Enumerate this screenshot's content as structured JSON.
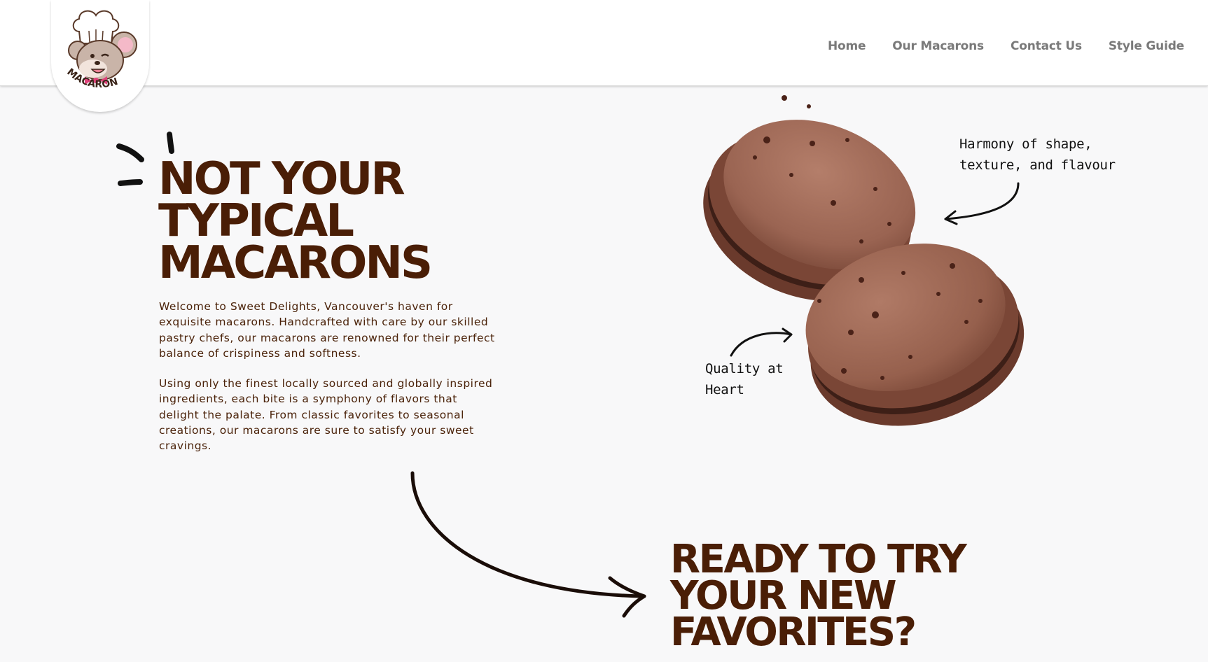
{
  "header": {
    "logo_text": "MACARON",
    "nav": [
      "Home",
      "Our Macarons",
      "Contact Us",
      "Style Guide"
    ]
  },
  "hero": {
    "title_lines": [
      "NOT YOUR",
      "TYPICAL",
      "MACARONS"
    ],
    "paragraph1": "Welcome to Sweet Delights, Vancouver's haven for exquisite macarons. Handcrafted with care by our skilled pastry chefs, our macarons are renowned for their perfect balance of crispiness and softness.",
    "paragraph2": "Using only the finest locally sourced and globally inspired ingredients, each bite is a symphony of flavors that delight the palate. From classic favorites to seasonal creations, our macarons are sure to satisfy your sweet cravings."
  },
  "annotations": {
    "note1": "Harmony of shape, texture, and flavour",
    "note2": "Quality at Heart"
  },
  "cta": {
    "title_lines": [
      "READY TO TRY",
      "YOUR NEW",
      "FAVORITES?"
    ]
  },
  "colors": {
    "brand_brown": "#4a1e06",
    "nav_gray": "#7a7a7a",
    "background": "#f8f8f9",
    "macaron": "#9c6653"
  }
}
